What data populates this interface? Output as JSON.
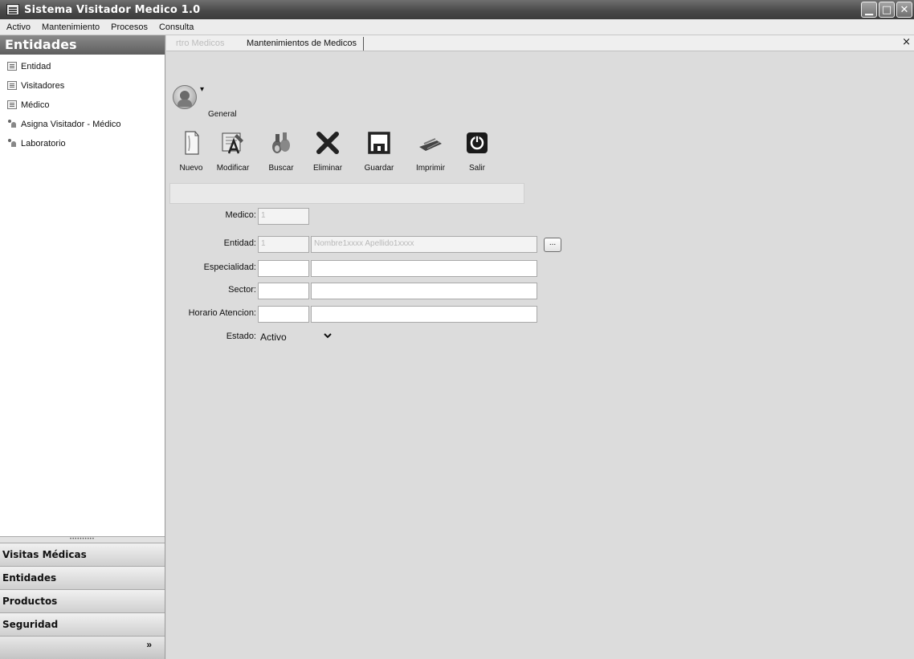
{
  "window": {
    "title": "Sistema Visitador Medico 1.0",
    "controls": [
      "▁",
      "□",
      "✕"
    ]
  },
  "menu": [
    "Activo",
    "Mantenimiento",
    "Procesos",
    "Consulta"
  ],
  "sidebar": {
    "header": "Entidades",
    "items": [
      {
        "label": "Entidad",
        "icon": "document-icon"
      },
      {
        "label": "Visitadores",
        "icon": "document-icon"
      },
      {
        "label": "Médico",
        "icon": "document-icon"
      },
      {
        "label": "Asigna Visitador - Médico",
        "icon": "people-icon"
      },
      {
        "label": "Laboratorio",
        "icon": "people-icon"
      }
    ],
    "groups": [
      "Visitas Médicas",
      "Entidades",
      "Productos",
      "Seguridad"
    ],
    "footer_glyph": "»"
  },
  "tabs": {
    "inactive": "rtro Medicos",
    "active": "Mantenimientos de Medicos",
    "close": "×"
  },
  "toolbar": {
    "avatar_dropdown": "▾",
    "group_label": "General",
    "buttons": [
      {
        "label": "Nuevo",
        "icon": "new-document-icon"
      },
      {
        "label": "Modificar",
        "icon": "edit-icon"
      },
      {
        "label": "Buscar",
        "icon": "search-binoculars-icon"
      },
      {
        "label": "Eliminar",
        "icon": "delete-x-icon"
      },
      {
        "label": "Guardar",
        "icon": "save-disk-icon"
      },
      {
        "label": "Imprimir",
        "icon": "print-icon"
      },
      {
        "label": "Salir",
        "icon": "power-icon"
      }
    ]
  },
  "form": {
    "medico": {
      "label": "Medico:",
      "value": "1"
    },
    "entidad": {
      "label": "Entidad:",
      "code": "1",
      "name": "Nombre1xxxx Apellido1xxxx",
      "lookup": "..."
    },
    "especialidad": {
      "label": "Especialidad:",
      "code": "",
      "name": ""
    },
    "sector": {
      "label": "Sector:",
      "code": "",
      "name": ""
    },
    "horario": {
      "label": "Horario Atencion:",
      "code": "",
      "name": ""
    },
    "estado": {
      "label": "Estado:",
      "value": "Activo"
    }
  }
}
